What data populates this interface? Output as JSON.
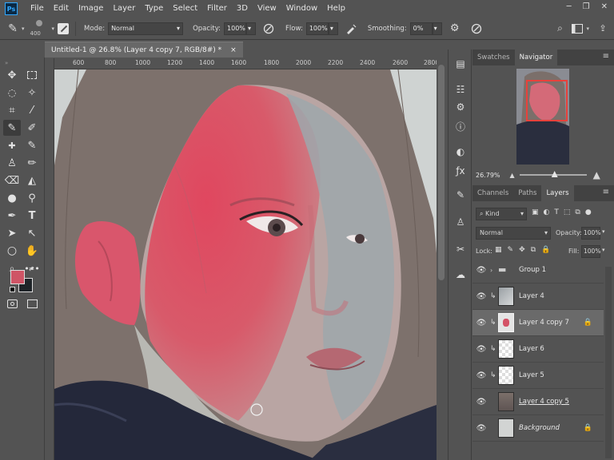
{
  "app": {
    "logo": "Ps"
  },
  "menu": [
    "File",
    "Edit",
    "Image",
    "Layer",
    "Type",
    "Select",
    "Filter",
    "3D",
    "View",
    "Window",
    "Help"
  ],
  "window_buttons": [
    "─",
    "❐",
    "✕"
  ],
  "options": {
    "brush_size": "400",
    "mode_label": "Mode:",
    "mode_value": "Normal",
    "opacity_label": "Opacity:",
    "opacity_value": "100%",
    "flow_label": "Flow:",
    "flow_value": "100%",
    "smoothing_label": "Smoothing:",
    "smoothing_value": "0%"
  },
  "document": {
    "tab_title": "Untitled-1 @ 26.8% (Layer 4 copy 7, RGB/8#) *",
    "close": "×"
  },
  "ruler": {
    "ticks": [
      "600",
      "800",
      "1000",
      "1200",
      "1400",
      "1600",
      "1800",
      "2000",
      "2200",
      "2400",
      "2600",
      "2800"
    ]
  },
  "navigator": {
    "tabs": [
      "Swatches",
      "Navigator"
    ],
    "active_tab": "Navigator",
    "zoom": "26.79%"
  },
  "layers_panel": {
    "tabs": [
      "Channels",
      "Paths",
      "Layers"
    ],
    "active_tab": "Layers",
    "filter_kind": "Kind",
    "blend_mode": "Normal",
    "opacity_label": "Opacity:",
    "opacity_value": "100%",
    "lock_label": "Lock:",
    "fill_label": "Fill:",
    "fill_value": "100%",
    "layers": [
      {
        "name": "Group 1",
        "type": "group"
      },
      {
        "name": "Layer 4",
        "clipped": true
      },
      {
        "name": "Layer 4 copy 7",
        "clipped": true,
        "selected": true,
        "locked": true
      },
      {
        "name": "Layer 6",
        "clipped": true
      },
      {
        "name": "Layer 5",
        "clipped": true
      },
      {
        "name": "Layer 4 copy 5"
      },
      {
        "name": "Background",
        "locked": true
      }
    ]
  },
  "colors": {
    "foreground": "#cf5566",
    "background": "#1f2428",
    "accent": "#31a8ff"
  }
}
